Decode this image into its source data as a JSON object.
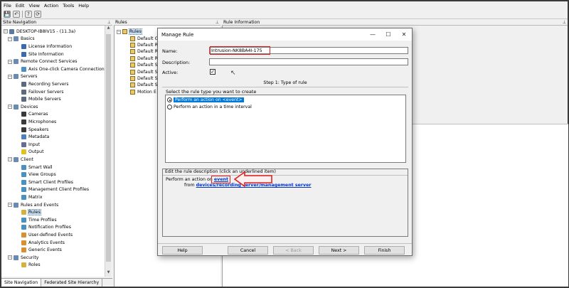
{
  "menu": [
    "File",
    "Edit",
    "View",
    "Action",
    "Tools",
    "Help"
  ],
  "toolbar": {
    "icons": [
      "save-icon",
      "undo-icon",
      "help-icon",
      "refresh-icon"
    ],
    "glyphs": {
      "save": "💾",
      "undo": "↶",
      "help": "?",
      "refresh": "⟳"
    }
  },
  "panes": {
    "site_navigation": "Site Navigation",
    "rules": "Rules",
    "rule_information": "Rule Information"
  },
  "tree": [
    {
      "label": "DESKTOP-IB8IV15 - (11.3a)",
      "level": 0,
      "exp": "−",
      "color": "#5a7aa0"
    },
    {
      "label": "Basics",
      "level": 1,
      "exp": "−",
      "color": "#6a8ab0"
    },
    {
      "label": "License Information",
      "level": 2,
      "color": "#3a6ab0"
    },
    {
      "label": "Site Information",
      "level": 2,
      "color": "#3a6ab0"
    },
    {
      "label": "Remote Connect Services",
      "level": 1,
      "exp": "−",
      "color": "#6a8ab0"
    },
    {
      "label": "Axis One-click Camera Connection",
      "level": 2,
      "color": "#4a90c0"
    },
    {
      "label": "Servers",
      "level": 1,
      "exp": "−",
      "color": "#6a8ab0"
    },
    {
      "label": "Recording Servers",
      "level": 2,
      "color": "#5a6a80"
    },
    {
      "label": "Failover Servers",
      "level": 2,
      "color": "#5a6a80"
    },
    {
      "label": "Mobile Servers",
      "level": 2,
      "color": "#5a6a80"
    },
    {
      "label": "Devices",
      "level": 1,
      "exp": "−",
      "color": "#6a8ab0"
    },
    {
      "label": "Cameras",
      "level": 2,
      "color": "#3a3a3a"
    },
    {
      "label": "Microphones",
      "level": 2,
      "color": "#3a3a3a"
    },
    {
      "label": "Speakers",
      "level": 2,
      "color": "#3a3a3a"
    },
    {
      "label": "Metadata",
      "level": 2,
      "color": "#4a80c0"
    },
    {
      "label": "Input",
      "level": 2,
      "color": "#6a6a9a"
    },
    {
      "label": "Output",
      "level": 2,
      "color": "#e0c020"
    },
    {
      "label": "Client",
      "level": 1,
      "exp": "−",
      "color": "#6a8ab0"
    },
    {
      "label": "Smart Wall",
      "level": 2,
      "color": "#4a90c0"
    },
    {
      "label": "View Groups",
      "level": 2,
      "color": "#4a90c0"
    },
    {
      "label": "Smart Client Profiles",
      "level": 2,
      "color": "#4a90c0"
    },
    {
      "label": "Management Client Profiles",
      "level": 2,
      "color": "#4a90c0"
    },
    {
      "label": "Matrix",
      "level": 2,
      "color": "#4a90c0"
    },
    {
      "label": "Rules and Events",
      "level": 1,
      "exp": "−",
      "color": "#6a8ab0"
    },
    {
      "label": "Rules",
      "level": 2,
      "color": "#d8b040",
      "selected": true
    },
    {
      "label": "Time Profiles",
      "level": 2,
      "color": "#4a90c0"
    },
    {
      "label": "Notification Profiles",
      "level": 2,
      "color": "#4a90c0"
    },
    {
      "label": "User-defined Events",
      "level": 2,
      "color": "#d89030"
    },
    {
      "label": "Analytics Events",
      "level": 2,
      "color": "#d89030"
    },
    {
      "label": "Generic Events",
      "level": 2,
      "color": "#d89030"
    },
    {
      "label": "Security",
      "level": 1,
      "exp": "−",
      "color": "#6a8ab0"
    },
    {
      "label": "Roles",
      "level": 2,
      "color": "#d8b040"
    }
  ],
  "nav_tabs": [
    "Site Navigation",
    "Federated Site Hierarchy"
  ],
  "rules_list": {
    "root": "Rules",
    "items": [
      "Default G",
      "Default R",
      "Default R",
      "Default R",
      "Default S",
      "Default S",
      "Default S",
      "Default S",
      "Motion E"
    ]
  },
  "dialog": {
    "title": "Manage Rule",
    "controls": [
      "—",
      "☐",
      "✕"
    ],
    "name_label": "Name:",
    "name_value": "Intrusion-NK8BA4I-175",
    "description_label": "Description:",
    "description_value": "",
    "active_label": "Active:",
    "active_check": "✓",
    "step_title": "Step 1: Type of rule",
    "select_prompt": "Select the rule type you want to create",
    "options": [
      "Perform an action on <event>",
      "Perform an action in a time interval"
    ],
    "desc_header": "Edit the rule description (click an underlined item)",
    "desc_prefix": "Perform an action on ",
    "desc_event": "event",
    "desc_from": "from ",
    "desc_source": "devices/recording server/management server",
    "buttons": {
      "help": "Help",
      "cancel": "Cancel",
      "back": "< Back",
      "next": "Next >",
      "finish": "Finish"
    }
  },
  "colors": {
    "accent": "#0078d7",
    "highlight_red": "#e02020",
    "link": "#0033cc"
  }
}
